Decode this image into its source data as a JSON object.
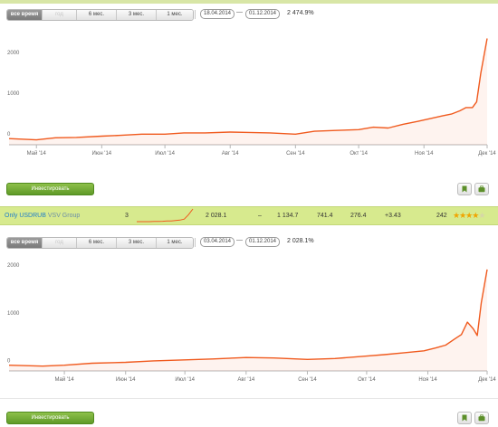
{
  "colors": {
    "accent": "#f05a1e",
    "highlight_row": "#d7ea8e",
    "invest_button": "#6aa82f",
    "star": "#f0a400"
  },
  "blocks": [
    {
      "periods": [
        "все время",
        "год",
        "6 мес.",
        "3 мес.",
        "1 мес."
      ],
      "active_period": "все время",
      "disabled_period": "год",
      "date_from": "18.04.2014",
      "date_to": "01.12.2014",
      "date_dash": "—",
      "return_pct": "2 474.9%",
      "y_ticks": [
        "2000",
        "1000",
        "0"
      ],
      "x_ticks": [
        "Май '14",
        "Июн '14",
        "Июл '14",
        "Авг '14",
        "Сен '14",
        "Окт '14",
        "Ноя '14",
        "Дек '14"
      ],
      "invest_label": "Инвестировать",
      "chart_data": {
        "type": "area",
        "title": "",
        "xlabel": "",
        "ylabel": "",
        "y_tick_values": [
          0,
          1000,
          2000
        ],
        "ylim": [
          -150,
          2550
        ],
        "xlim": [
          "2014-04-18",
          "2014-12-01"
        ],
        "x_tick_dates": [
          "2014-05-01",
          "2014-06-01",
          "2014-07-01",
          "2014-08-01",
          "2014-09-01",
          "2014-10-01",
          "2014-11-01",
          "2014-12-01"
        ],
        "x": [
          "2014-04-18",
          "2014-05-01",
          "2014-05-10",
          "2014-05-20",
          "2014-06-01",
          "2014-06-10",
          "2014-06-20",
          "2014-07-01",
          "2014-07-10",
          "2014-07-20",
          "2014-08-01",
          "2014-08-10",
          "2014-08-20",
          "2014-09-01",
          "2014-09-10",
          "2014-09-20",
          "2014-10-01",
          "2014-10-08",
          "2014-10-15",
          "2014-10-22",
          "2014-10-29",
          "2014-11-05",
          "2014-11-10",
          "2014-11-14",
          "2014-11-18",
          "2014-11-21",
          "2014-11-24",
          "2014-11-26",
          "2014-11-28",
          "2014-12-01"
        ],
        "values": [
          0,
          -30,
          20,
          30,
          60,
          80,
          110,
          110,
          140,
          140,
          160,
          150,
          140,
          110,
          180,
          200,
          220,
          280,
          260,
          350,
          420,
          500,
          560,
          600,
          680,
          760,
          760,
          900,
          1600,
          2450
        ],
        "grid": false,
        "legend": "none"
      }
    },
    {
      "periods": [
        "все время",
        "год",
        "6 мес.",
        "3 мес.",
        "1 мес."
      ],
      "active_period": "все время",
      "disabled_period": "год",
      "date_from": "03.04.2014",
      "date_to": "01.12.2014",
      "date_dash": "—",
      "return_pct": "2 028.1%",
      "y_ticks": [
        "2000",
        "1000",
        "0"
      ],
      "x_ticks": [
        "Май '14",
        "Июн '14",
        "Июл '14",
        "Авг '14",
        "Сен '14",
        "Окт '14",
        "Ноя '14",
        "Дек '14"
      ],
      "invest_label": "Инвестировать",
      "chart_data": {
        "type": "area",
        "title": "",
        "xlabel": "",
        "ylabel": "",
        "y_tick_values": [
          0,
          1000,
          2000
        ],
        "ylim": [
          -120,
          2150
        ],
        "xlim": [
          "2014-04-03",
          "2014-12-01"
        ],
        "x_tick_dates": [
          "2014-05-01",
          "2014-06-01",
          "2014-07-01",
          "2014-08-01",
          "2014-09-01",
          "2014-10-01",
          "2014-11-01",
          "2014-12-01"
        ],
        "x": [
          "2014-04-03",
          "2014-04-20",
          "2014-05-01",
          "2014-05-15",
          "2014-06-01",
          "2014-06-15",
          "2014-07-01",
          "2014-07-15",
          "2014-08-01",
          "2014-08-15",
          "2014-09-01",
          "2014-09-15",
          "2014-10-01",
          "2014-10-10",
          "2014-10-20",
          "2014-10-30",
          "2014-11-05",
          "2014-11-10",
          "2014-11-15",
          "2014-11-18",
          "2014-11-21",
          "2014-11-24",
          "2014-11-26",
          "2014-11-28",
          "2014-12-01"
        ],
        "values": [
          0,
          -20,
          0,
          40,
          60,
          90,
          110,
          130,
          160,
          150,
          120,
          140,
          190,
          220,
          260,
          300,
          360,
          420,
          560,
          640,
          900,
          760,
          620,
          1300,
          2000
        ],
        "grid": false,
        "legend": "none"
      }
    }
  ],
  "strategy": {
    "name": "Only USDRUB",
    "manager": "VSV Group",
    "col1": "3",
    "sparkline": [
      0,
      0,
      0,
      0,
      0.02,
      0.02,
      0.03,
      0.05,
      0.06,
      0.09,
      0.12,
      0.2,
      0.55,
      1
    ],
    "return_val": "2 028.1",
    "dash": "–",
    "val2": "1 134.7",
    "val3": "741.4",
    "val4": "276.4",
    "change": "+3.43",
    "count": "242",
    "rating": 4,
    "rating_max": 5
  }
}
